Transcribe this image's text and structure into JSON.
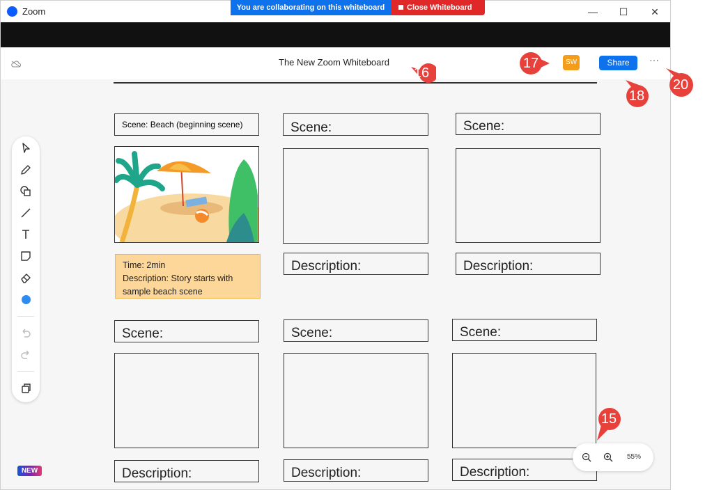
{
  "window": {
    "app_title": "Zoom",
    "minimize": "—",
    "maximize": "☐",
    "close": "✕"
  },
  "banner": {
    "collab": "You are collaborating on this whiteboard",
    "close_whiteboard": "Close Whiteboard"
  },
  "whiteboard": {
    "title": "The New Zoom Whiteboard",
    "avatar_initials": "SW",
    "share": "Share",
    "more": "···"
  },
  "cards": {
    "scene_first": "Scene: Beach (beginning scene)",
    "scene_label": "Scene:",
    "description_label": "Description:",
    "note_line1": "Time: 2min",
    "note_line2": "Description: Story starts with sample beach scene"
  },
  "zoom": {
    "level": "55%"
  },
  "badge": {
    "new": "NEW"
  },
  "callouts": [
    "15",
    "16",
    "17",
    "18",
    "20"
  ],
  "colors": {
    "accent": "#0e72ed",
    "close_red": "#e02828",
    "avatar": "#f49d1b",
    "note": "#fdd69a",
    "callout": "#e8403a"
  }
}
